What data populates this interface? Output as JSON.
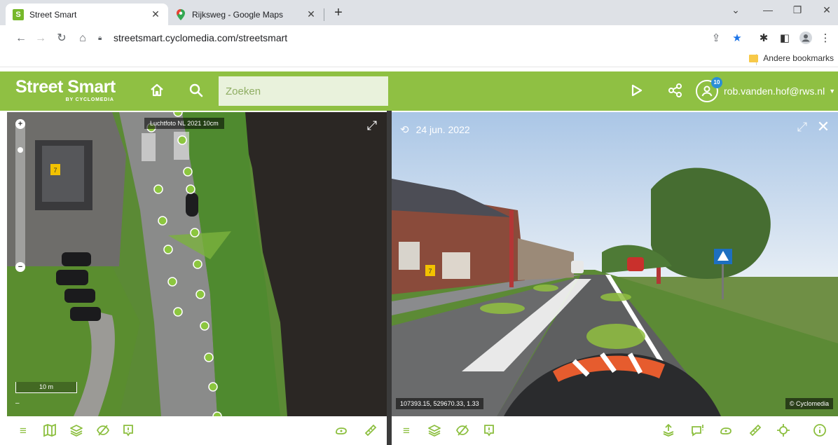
{
  "browser": {
    "tabs": [
      {
        "title": "Street Smart",
        "favicon": "S"
      },
      {
        "title": "Rijksweg - Google Maps"
      }
    ],
    "url": "streetsmart.cyclomedia.com/streetsmart",
    "bookmarks_label": "Andere bookmarks"
  },
  "app": {
    "logo_main": "Street Smart",
    "logo_sub": "BY CYCLOMEDIA",
    "search_placeholder": "Zoeken",
    "user_email": "rob.vanden.hof@rws.nl",
    "notification_count": "10",
    "accent_color": "#8fc043"
  },
  "map": {
    "layer_label": "Luchtfoto NL 2021 10cm",
    "scale_label": "10 m",
    "house_number": "7"
  },
  "panorama": {
    "date": "24 jun. 2022",
    "coordinates": "107393.15, 529670.33, 1.33",
    "copyright": "© Cyclomedia",
    "house_number": "7"
  }
}
